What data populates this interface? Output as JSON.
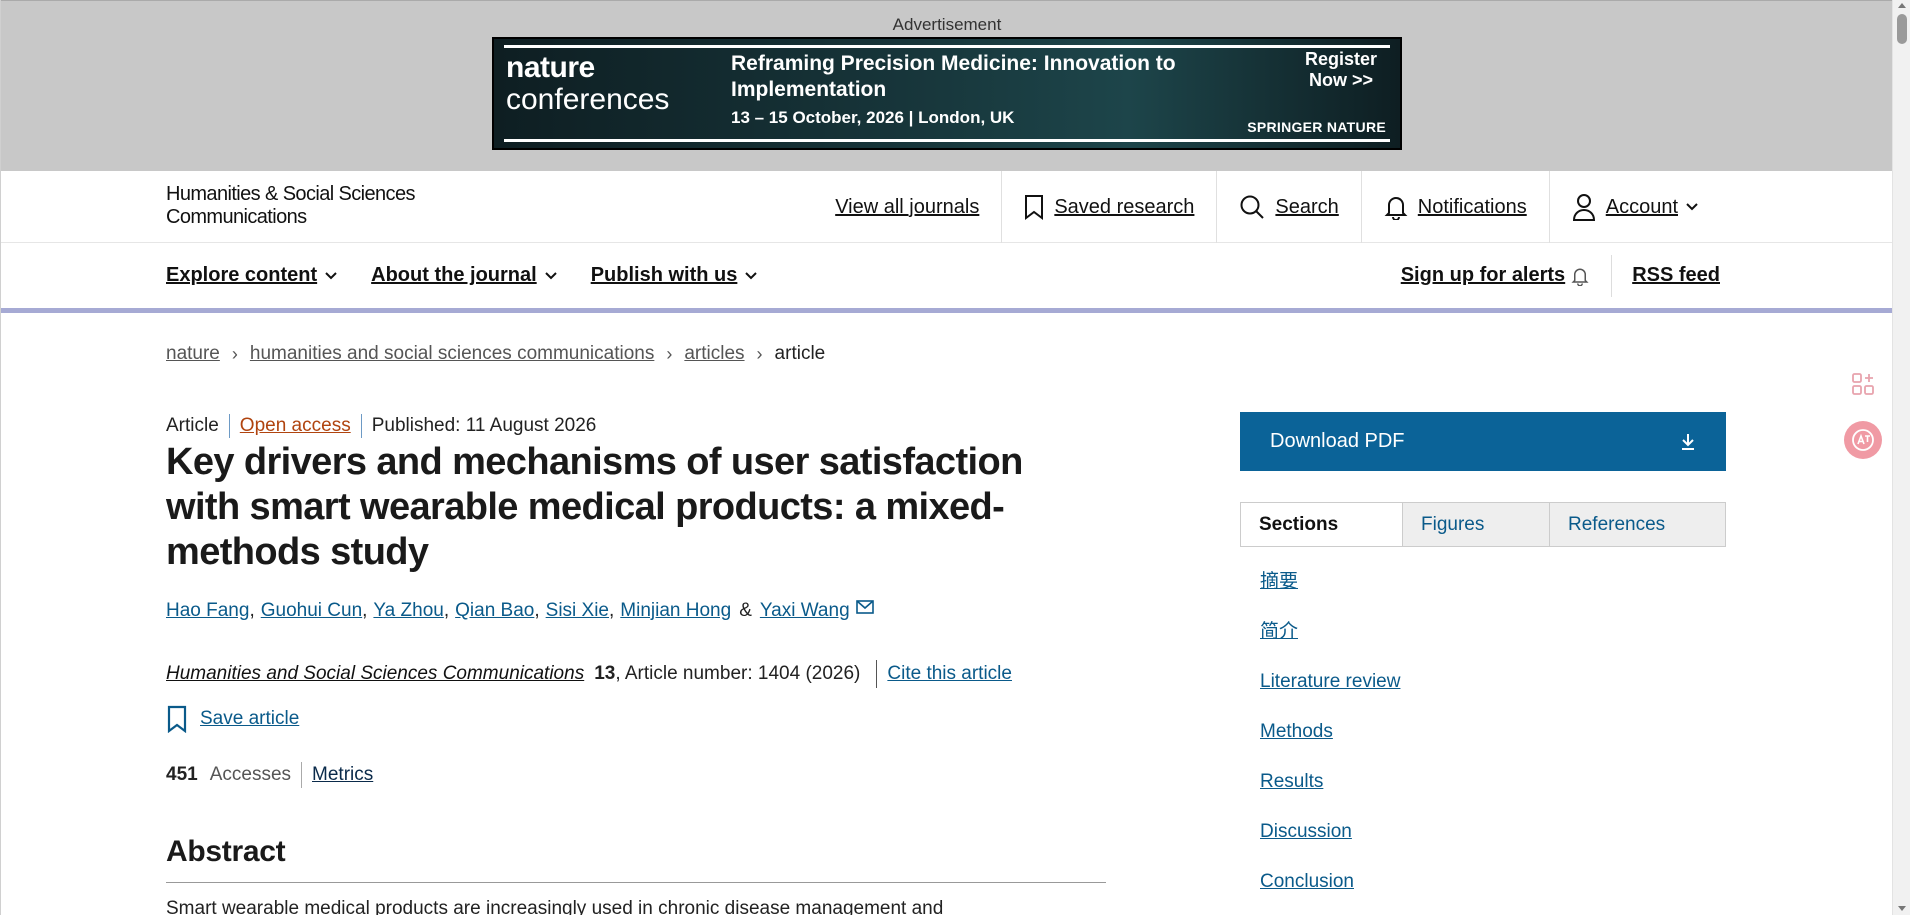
{
  "ad": {
    "label": "Advertisement",
    "brand_line1": "nature",
    "brand_line2": "conferences",
    "title": "Reframing Precision Medicine: Innovation to Implementation",
    "date_location": "13 – 15 October, 2026  |  London, UK",
    "cta": "Register Now >>",
    "publisher": "SPRINGER NATURE"
  },
  "header": {
    "logo_line1": "Humanities & Social Sciences",
    "logo_line2": "Communications",
    "nav": {
      "view_all": "View all journals",
      "saved": "Saved research",
      "search": "Search",
      "notifications": "Notifications",
      "account": "Account"
    }
  },
  "subnav": {
    "explore": "Explore content",
    "about": "About the journal",
    "publish": "Publish with us",
    "alerts": "Sign up for alerts",
    "rss": "RSS feed"
  },
  "breadcrumb": [
    "nature",
    "humanities and social sciences communications",
    "articles",
    "article"
  ],
  "article": {
    "type": "Article",
    "access": "Open access",
    "published": "Published: 11 August 2026",
    "title": "Key drivers and mechanisms of user satisfaction with smart wearable medical products: a mixed-methods study",
    "authors": [
      "Hao Fang",
      "Guohui Cun",
      "Ya Zhou",
      "Qian Bao",
      "Sisi Xie",
      "Minjian Hong",
      "Yaxi Wang"
    ],
    "author_separator": "&",
    "journal": "Humanities and Social Sciences Communications",
    "volume": "13",
    "article_number": ", Article number: 1404 (2026)",
    "cite": "Cite this article",
    "save": "Save article",
    "accesses_count": "451",
    "accesses_label": "Accesses",
    "metrics": "Metrics",
    "abstract_heading": "Abstract",
    "abstract_text": "Smart wearable medical products are increasingly used in chronic disease management and"
  },
  "sidebar": {
    "download": "Download PDF",
    "tabs": [
      "Sections",
      "Figures",
      "References"
    ],
    "active_tab": "Sections",
    "sections": [
      "摘要",
      "简介",
      "Literature review",
      "Methods",
      "Results",
      "Discussion",
      "Conclusion"
    ]
  },
  "colors": {
    "accent_blue": "#0b6398",
    "link_blue": "#0a5a8a",
    "open_access": "#b0440f",
    "nav_rule": "#a6aad4"
  }
}
